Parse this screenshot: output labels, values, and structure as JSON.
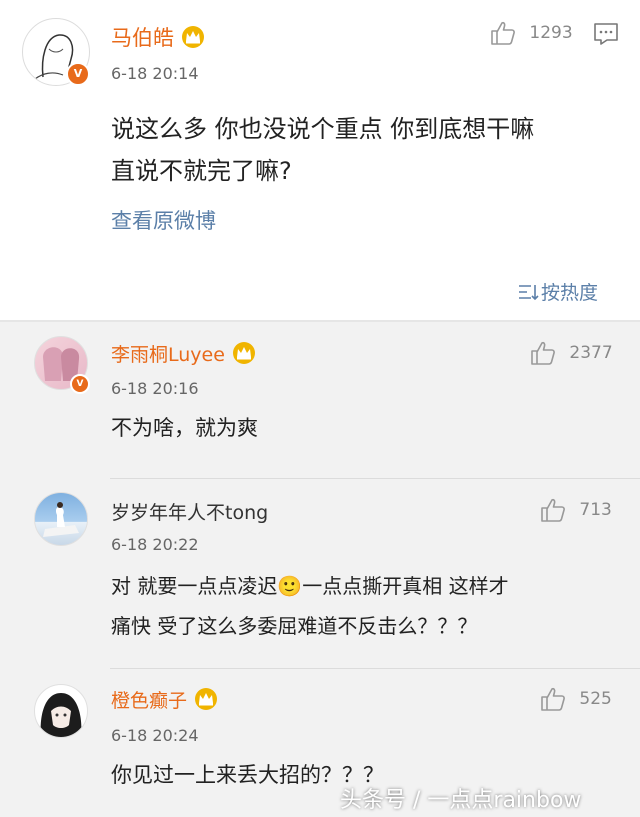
{
  "post": {
    "username": "马伯皓",
    "time": "6-18 20:14",
    "likes": "1293",
    "text_line1": "说这么多 你也没说个重点 你到底想干嘛",
    "text_line2": "直说不就完了嘛?",
    "view_original": "查看原微博",
    "sort_label": "按热度"
  },
  "comments": [
    {
      "username": "李雨桐Luyee",
      "time": "6-18 20:16",
      "likes": "2377",
      "text_line1": "不为啥，就为爽",
      "text_line2": ""
    },
    {
      "username": "岁岁年年人不tong",
      "time": "6-18 20:22",
      "likes": "713",
      "text_line1": "对 就要一点点凌迟🙂一点点撕开真相  这样才",
      "text_line2": "痛快  受了这么多委屈难道不反击么？？？"
    },
    {
      "username": "橙色癫子",
      "time": "6-18 20:24",
      "likes": "525",
      "text_line1": "你见过一上来丢大招的？？？",
      "text_line2": ""
    }
  ],
  "watermark": "头条号 / 一点点rainbow",
  "colors": {
    "username_orange": "#e86a1a",
    "link_blue": "#5b7fa8",
    "badge_gold": "#f0b400"
  }
}
